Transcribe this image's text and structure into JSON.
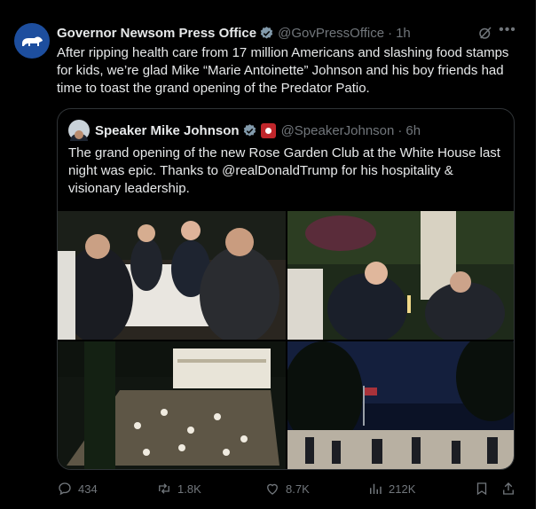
{
  "tweet": {
    "name": "Governor Newsom Press Office",
    "handle": "@GovPressOffice",
    "separator": "·",
    "time": "1h",
    "text": "After ripping health care from 17 million Americans and slashing food stamps for kids, we’re glad Mike “Marie Antoinette” Johnson and his boy friends had time to toast the grand opening of the Predator Patio."
  },
  "quote": {
    "name": "Speaker Mike Johnson",
    "handle": "@SpeakerJohnson",
    "separator": "·",
    "time": "6h",
    "text": "The grand opening of the new Rose Garden Club at the White House last night was epic. Thanks to @realDonaldTrump for his hospitality & visionary leadership."
  },
  "actions": {
    "replies": "434",
    "reposts": "1.8K",
    "likes": "8.7K",
    "views": "212K"
  },
  "icons": {
    "avatar": "california-bear-icon",
    "verified": "verified-badge-icon",
    "grok": "grok-icon",
    "more": "more-icon",
    "reply": "reply-icon",
    "repost": "repost-icon",
    "like": "heart-icon",
    "views": "views-icon",
    "bookmark": "bookmark-icon",
    "share": "share-icon"
  },
  "colors": {
    "background": "#000000",
    "text": "#e7e9ea",
    "muted": "#71767b",
    "verified": "#829aab",
    "border": "#2f3336"
  }
}
